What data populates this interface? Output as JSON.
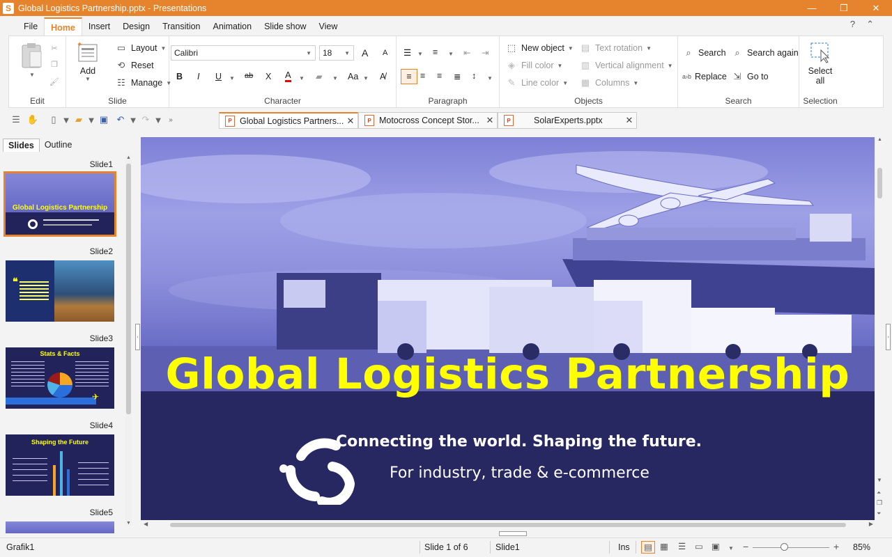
{
  "window": {
    "app_icon": "S",
    "title": "Global Logistics Partnership.pptx - Presentations",
    "minimize": "—",
    "maximize": "❐",
    "close": "✕"
  },
  "menu": {
    "items": [
      "File",
      "Home",
      "Insert",
      "Design",
      "Transition",
      "Animation",
      "Slide show",
      "View"
    ],
    "active": "Home",
    "help": "?",
    "collapse": "⌃"
  },
  "ribbon": {
    "edit": {
      "label": "Edit"
    },
    "slide": {
      "label": "Slide",
      "add": "Add",
      "layout": "Layout",
      "reset": "Reset",
      "manage": "Manage"
    },
    "character": {
      "label": "Character",
      "font": "Calibri",
      "size": "18",
      "bold": "B",
      "italic": "I",
      "underline": "U",
      "strike": "ab",
      "clear": "X",
      "fontcolor": "A",
      "case": "Aa",
      "grow": "A",
      "shrink": "A"
    },
    "paragraph": {
      "label": "Paragraph"
    },
    "objects": {
      "label": "Objects",
      "new_object": "New object",
      "fill_color": "Fill color",
      "line_color": "Line color",
      "text_rotation": "Text rotation",
      "vertical_alignment": "Vertical alignment",
      "columns": "Columns"
    },
    "search": {
      "label": "Search",
      "search": "Search",
      "search_again": "Search again",
      "replace": "Replace",
      "goto": "Go to",
      "replace_icon": "a›b"
    },
    "selection": {
      "label": "Selection",
      "select_all_1": "Select",
      "select_all_2": "all"
    }
  },
  "doc_tabs": [
    {
      "label": "Global Logistics Partners...",
      "active": true
    },
    {
      "label": "Motocross Concept Stor...",
      "active": false
    },
    {
      "label": "SolarExperts.pptx",
      "active": false
    }
  ],
  "panel": {
    "tabs": [
      "Slides",
      "Outline"
    ],
    "active_tab": "Slides",
    "slides": [
      "Slide1",
      "Slide2",
      "Slide3",
      "Slide4",
      "Slide5"
    ],
    "selected": "Slide1",
    "thumb1_title": "Global Logistics Partnership",
    "thumb3_title": "Stats & Facts",
    "thumb4_title": "Shaping the Future"
  },
  "slide": {
    "title": "Global Logistics Partnership",
    "subtitle": "Connecting the world. Shaping the future.",
    "tagline": "For industry, trade & e-commerce"
  },
  "status": {
    "object": "Grafik1",
    "slide_pos": "Slide 1 of 6",
    "slide_name": "Slide1",
    "mode": "Ins",
    "zoom": "85%",
    "zoom_minus": "−",
    "zoom_plus": "+"
  },
  "colors": {
    "accent": "#e5842c",
    "slide_bg": "#272762",
    "title_yellow": "#ffff00"
  }
}
